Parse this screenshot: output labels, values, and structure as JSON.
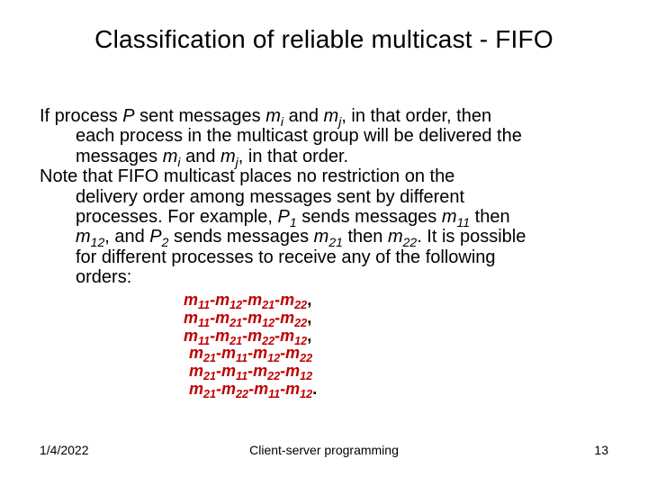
{
  "title": "Classification of reliable multicast - FIFO",
  "para1": {
    "a": "If process ",
    "P": "P",
    "b": " sent messages ",
    "m": "m",
    "i": "i",
    "and": " and ",
    "j": "j",
    "c": ", in that order, then",
    "line2": "each process in the multicast group will be delivered the",
    "line3a": "messages ",
    "line3b": " and ",
    "line3c": ", in that order."
  },
  "para2": {
    "l1": "Note that FIFO multicast places no restriction on the",
    "l2": "delivery order among messages sent by different",
    "l3a": "processes. For example, ",
    "P": "P",
    "s1": "1",
    "l3b": " sends messages ",
    "m": "m",
    "s11": "11",
    "l3c": " then",
    "l4a_s12": "12",
    "l4b": ", and ",
    "s2": "2",
    "l4c": " sends messages ",
    "s21": "21",
    "l4d": " then ",
    "s22": "22",
    "l4e": ". It is possible",
    "l5": "for different processes to receive any of the following",
    "l6": "orders:"
  },
  "ord": {
    "m": "m",
    "dash": "-",
    "comma": ",",
    "period": ".",
    "s11": "11",
    "s12": "12",
    "s21": "21",
    "s22": "22"
  },
  "footer": {
    "date": "1/4/2022",
    "center": "Client-server programming",
    "page": "13"
  }
}
